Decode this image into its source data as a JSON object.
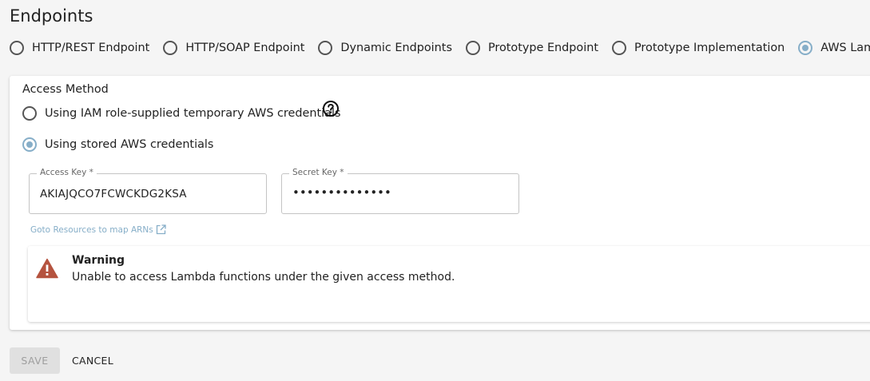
{
  "page": {
    "title": "Endpoints"
  },
  "endpoint_types": [
    {
      "label": "HTTP/REST Endpoint",
      "selected": false
    },
    {
      "label": "HTTP/SOAP Endpoint",
      "selected": false
    },
    {
      "label": "Dynamic Endpoints",
      "selected": false
    },
    {
      "label": "Prototype Endpoint",
      "selected": false
    },
    {
      "label": "Prototype Implementation",
      "selected": false
    },
    {
      "label": "AWS Lambda",
      "selected": true
    }
  ],
  "access_method": {
    "title": "Access Method",
    "options": [
      {
        "label": "Using IAM role-supplied temporary AWS credentials",
        "selected": false
      },
      {
        "label": "Using stored AWS credentials",
        "selected": true
      }
    ],
    "help_icon": "help-circle-icon"
  },
  "credentials": {
    "access_key": {
      "label": "Access Key *",
      "value": "AKIAJQCO7FCWCKDG2KSA"
    },
    "secret_key": {
      "label": "Secret Key *",
      "value": "••••••••••••••"
    }
  },
  "goto_link": {
    "label": "Goto Resources to map ARNs",
    "icon": "open-in-new-icon"
  },
  "warning": {
    "icon": "warning-triangle-icon",
    "title": "Warning",
    "message": "Unable to access Lambda functions under the given access method."
  },
  "actions": {
    "save_label": "SAVE",
    "cancel_label": "CANCEL"
  },
  "colors": {
    "accent": "#86aec8",
    "warning": "#b5533f",
    "background": "#f5f5f5"
  }
}
